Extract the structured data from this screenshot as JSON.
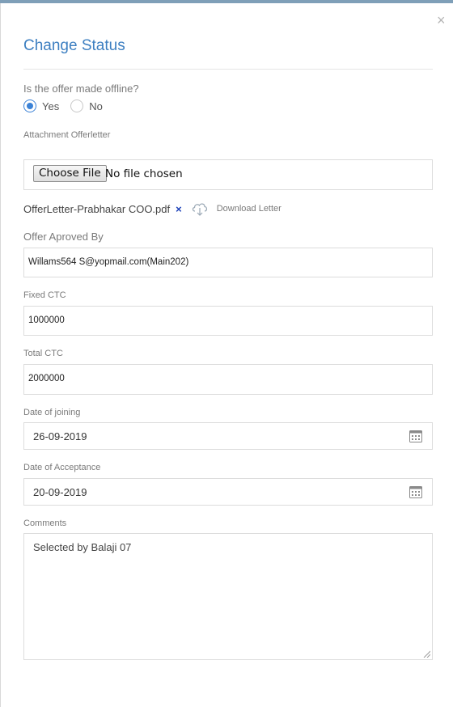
{
  "dialog": {
    "title": "Change Status",
    "close_label": "×"
  },
  "offline": {
    "question": "Is the offer made offline?",
    "options": [
      {
        "label": "Yes",
        "checked": true
      },
      {
        "label": "No",
        "checked": false
      }
    ]
  },
  "attachment": {
    "label": "Attachment Offerletter",
    "choose_button": "Choose File",
    "file_status": "No file chosen",
    "file_name": "OfferLetter-Prabhakar COO.pdf",
    "remove_icon": "×",
    "download_label": "Download Letter"
  },
  "approved_by": {
    "label": "Offer Aproved By",
    "value": "Willams564 S@yopmail.com(Main202)"
  },
  "fixed_ctc": {
    "label": "Fixed CTC",
    "value": "1000000"
  },
  "total_ctc": {
    "label": "Total CTC",
    "value": "2000000"
  },
  "date_joining": {
    "label": "Date of joining",
    "value": "26-09-2019"
  },
  "date_acceptance": {
    "label": "Date of Acceptance",
    "value": "20-09-2019"
  },
  "comments": {
    "label": "Comments",
    "value": "Selected by Balaji 07"
  },
  "icons": [
    "close-icon",
    "remove-file-icon",
    "cloud-download-icon",
    "calendar-icon",
    "resize-grip-icon"
  ],
  "colors": {
    "accent": "#3d7fc1",
    "radio": "#3b82d6",
    "remove": "#1a3fb8"
  }
}
